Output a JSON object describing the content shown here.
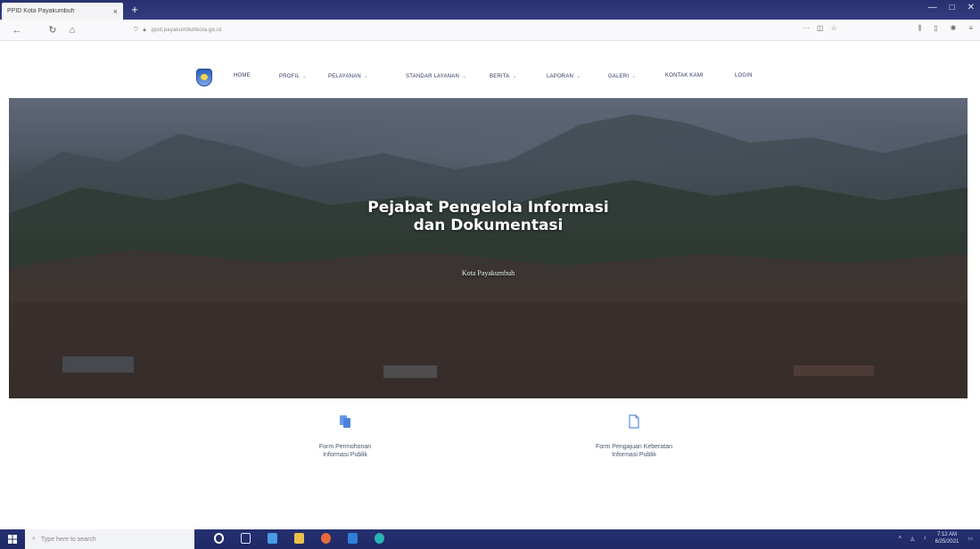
{
  "browser": {
    "tab_title": "PPID Kota Payakumbuh",
    "tab_close": "×",
    "new_tab": "+",
    "url": "ppid.payakumbuhkota.go.id",
    "window_controls": [
      "—",
      "□",
      "✕"
    ]
  },
  "site": {
    "menu": [
      {
        "label": "HOME",
        "has_caret": false
      },
      {
        "label": "PROFIL",
        "has_caret": true
      },
      {
        "label": "PELAYANAN",
        "has_caret": true
      },
      {
        "label": "STANDAR LAYANAN",
        "has_caret": true
      },
      {
        "label": "BERITA",
        "has_caret": true
      },
      {
        "label": "LAPORAN",
        "has_caret": true
      },
      {
        "label": "GALERI",
        "has_caret": true
      },
      {
        "label": "KONTAK KAMI",
        "has_caret": false
      },
      {
        "label": "LOGIN",
        "has_caret": false
      }
    ],
    "hero": {
      "title_line1": "Pejabat Pengelola Informasi",
      "title_line2": "dan Dokumentasi",
      "subtitle": "Kota Payakumbuh"
    },
    "features": [
      {
        "line1": "Form Permohonan",
        "line2": "Informasi Publik",
        "icon": "documents-icon"
      },
      {
        "line1": "Form Pengajuan Keberatan",
        "line2": "Informasi Publik",
        "icon": "document-icon"
      }
    ],
    "accent_color": "#5a8ee0"
  },
  "taskbar": {
    "search_placeholder": "Type here to search",
    "time": "7:12 AM",
    "date": "6/25/2021"
  }
}
